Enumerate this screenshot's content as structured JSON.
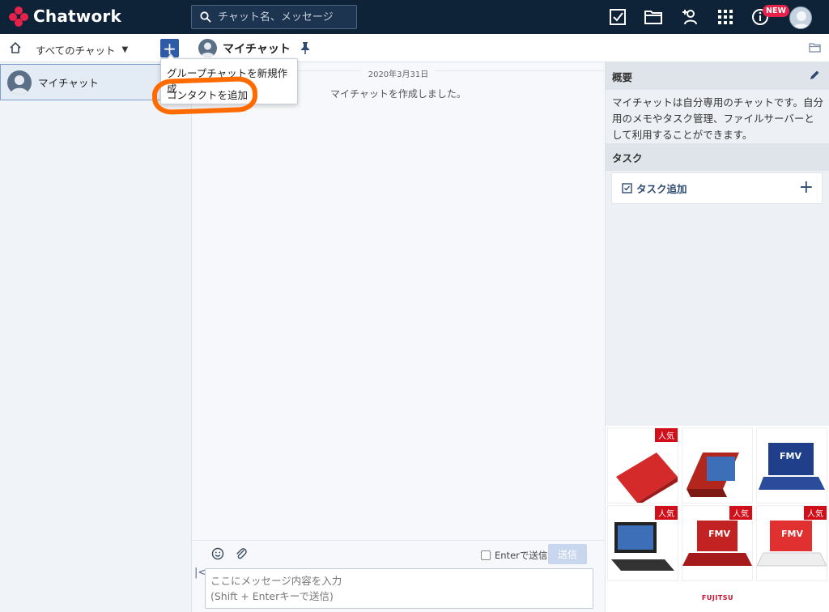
{
  "header": {
    "logo_text": "Chatwork",
    "search_placeholder": "チャット名、メッセージ",
    "new_badge": "NEW",
    "icons": [
      "task-check-icon",
      "folder-icon",
      "add-contact-icon",
      "apps-grid-icon",
      "info-icon",
      "avatar"
    ]
  },
  "sidebar": {
    "filter_label": "すべてのチャット",
    "add_button_label": "+",
    "chats": [
      {
        "name": "マイチャット",
        "selected": true
      }
    ]
  },
  "dropdown": {
    "items": [
      {
        "label": "グループチャットを新規作成"
      },
      {
        "label": "コンタクトを追加"
      }
    ],
    "highlighted_index": 1,
    "annotation_color": "#ff6b00"
  },
  "chat": {
    "title": "マイチャット",
    "date": "2020年3月31日",
    "system_message": "マイチャットを作成しました。"
  },
  "composer": {
    "enter_send_label": "Enterで送信",
    "send_button": "送信",
    "placeholder": "ここにメッセージ内容を入力\n(Shift + Enterキーで送信)"
  },
  "right_panel": {
    "overview_title": "概要",
    "overview_text": "マイチャットは自分専用のチャットです。自分用のメモやタスク管理、ファイルサーバーとして利用することができます。",
    "task_title": "タスク",
    "task_add_label": "タスク追加"
  },
  "ad": {
    "badges": [
      "人気",
      "",
      "",
      "人気",
      "人気",
      "人気"
    ],
    "brand": "FUJITSU",
    "fmv_label": "FMV"
  },
  "colors": {
    "header_bg": "#0e2238",
    "accent": "#2e5aa8",
    "logo_red": "#e5234a"
  }
}
